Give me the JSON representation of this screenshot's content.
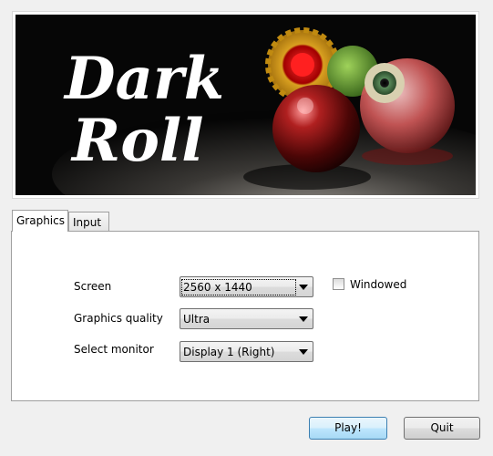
{
  "banner": {
    "logo_line1": "Dark",
    "logo_line2": "Roll"
  },
  "tabs": [
    {
      "label": "Graphics",
      "active": true
    },
    {
      "label": "Input",
      "active": false
    }
  ],
  "settings": {
    "screen": {
      "label": "Screen",
      "value": "2560 x 1440"
    },
    "windowed": {
      "label": "Windowed",
      "checked": false
    },
    "quality": {
      "label": "Graphics quality",
      "value": "Ultra"
    },
    "monitor": {
      "label": "Select monitor",
      "value": "Display 1 (Right)"
    }
  },
  "buttons": {
    "play": "Play!",
    "quit": "Quit"
  },
  "colors": {
    "accent": "#3c7fb1",
    "banner_bg": "#0b0b0b"
  }
}
